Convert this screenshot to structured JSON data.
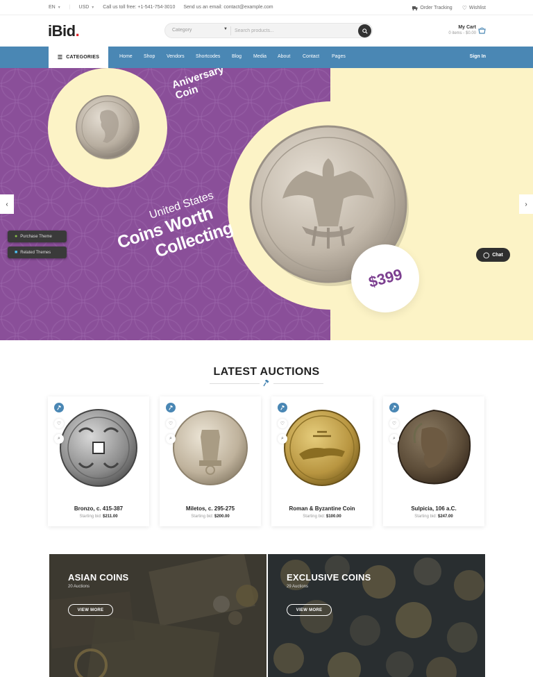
{
  "topbar": {
    "language": "EN",
    "currency": "USD",
    "phone": "Call us toll free: +1-541-754-3010",
    "email": "Send us an email: contact@example.com",
    "order_tracking": "Order Tracking",
    "wishlist": "Wishlist"
  },
  "header": {
    "logo_text": "iBid",
    "logo_dot": ".",
    "search_category": "Category",
    "search_placeholder": "Search products...",
    "cart_label": "My Cart",
    "cart_summary": "0 items - $0.00"
  },
  "nav": {
    "categories_label": "CATEGORIES",
    "links": [
      "Home",
      "Shop",
      "Vendors",
      "Shortcodes",
      "Blog",
      "Media",
      "About",
      "Contact",
      "Pages"
    ],
    "sign_in": "Sign In"
  },
  "hero": {
    "badge_text": "Aniversary Coin",
    "subtitle": "United States",
    "title_line1": "Coins Worth",
    "title_line2": "Collecting",
    "price": "$399",
    "purchase_theme": "Purchase Theme",
    "related_themes": "Related Themes",
    "chat_label": "Chat"
  },
  "auctions": {
    "title": "LATEST AUCTIONS",
    "starting_bid_label": "Starting bid:",
    "items": [
      {
        "name": "Bronzo, c. 415-387",
        "price": "$211.00"
      },
      {
        "name": "Miletos, c. 295-275",
        "price": "$200.00"
      },
      {
        "name": "Roman & Byzantine Coin",
        "price": "$100.00"
      },
      {
        "name": "Sulpicia, 106 a.C.",
        "price": "$247.00"
      }
    ]
  },
  "banners": [
    {
      "title": "ASIAN COINS",
      "count": "20 Auctions",
      "button": "VIEW MORE"
    },
    {
      "title": "EXCLUSIVE COINS",
      "count": "29 Auctions",
      "button": "VIEW MORE"
    }
  ],
  "colors": {
    "brand_blue": "#4a87b4",
    "hero_purple": "#8a4f99",
    "hero_cream": "#fcf3c6",
    "logo_accent": "#e1242b",
    "price_purple": "#7c3f90"
  }
}
